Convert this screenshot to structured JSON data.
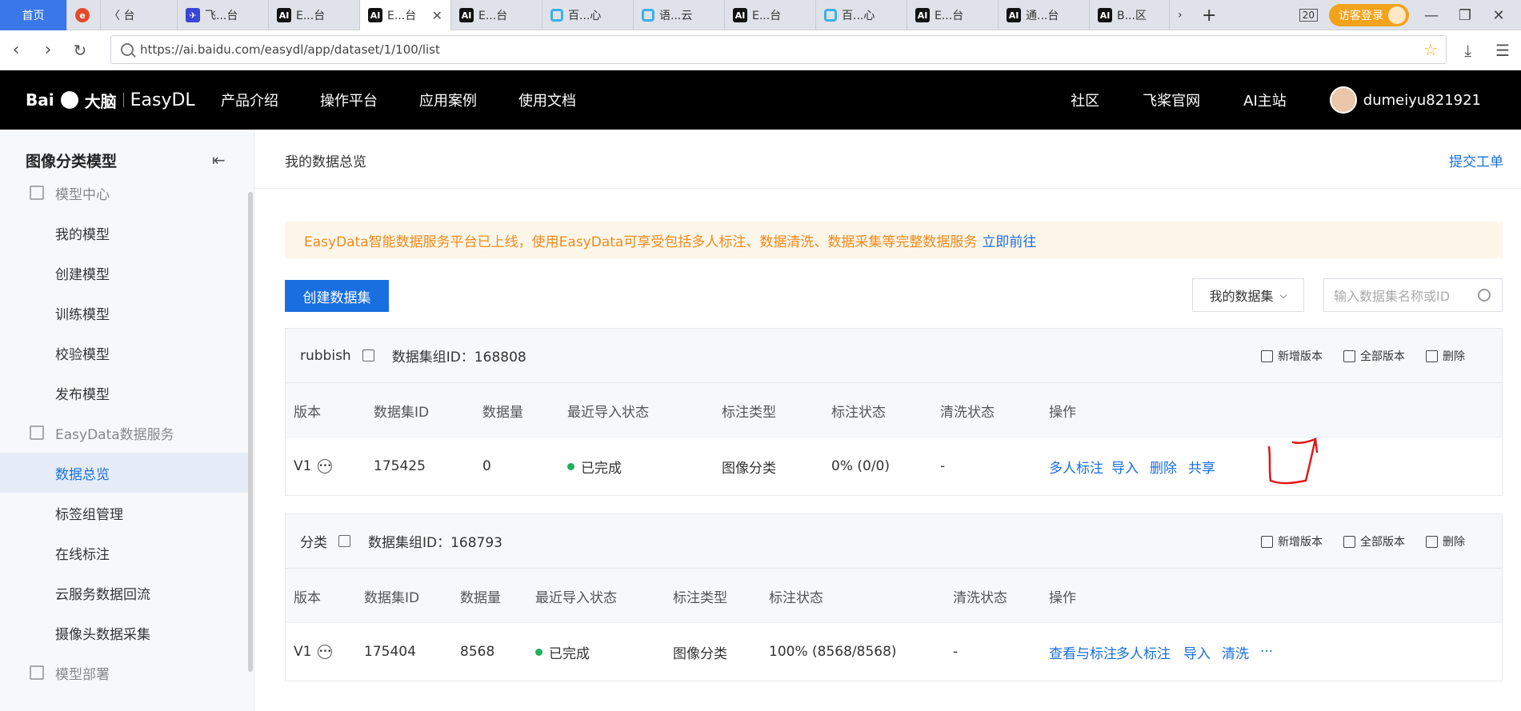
{
  "browser": {
    "home_tab": "首页",
    "tabs": [
      {
        "icon": "red",
        "label": ""
      },
      {
        "icon": "none",
        "label": "〈 台"
      },
      {
        "icon": "blue",
        "label": "飞...台"
      },
      {
        "icon": "ai",
        "label": "E...台"
      },
      {
        "icon": "ai",
        "label": "E...台",
        "active": true
      },
      {
        "icon": "ai",
        "label": "E...台"
      },
      {
        "icon": "hex",
        "label": "百...心"
      },
      {
        "icon": "hex",
        "label": "语...云"
      },
      {
        "icon": "ai",
        "label": "E...台"
      },
      {
        "icon": "hex",
        "label": "百...心"
      },
      {
        "icon": "ai",
        "label": "E...台"
      },
      {
        "icon": "ai",
        "label": "通...台"
      },
      {
        "icon": "ai",
        "label": "B...区"
      }
    ],
    "tab_count": "20",
    "visitor_login": "访客登录",
    "url": "https://ai.baidu.com/easydl/app/dataset/1/100/list"
  },
  "header": {
    "logo_text": "Bai",
    "logo_cn": "大脑",
    "product": "EasyDL",
    "nav": [
      "产品介绍",
      "操作平台",
      "应用案例",
      "使用文档"
    ],
    "right_links": [
      "社区",
      "飞桨官网",
      "AI主站"
    ],
    "username": "dumeiyu821921"
  },
  "sidebar": {
    "title": "图像分类模型",
    "items": [
      {
        "label": "模型中心",
        "group": true
      },
      {
        "label": "我的模型"
      },
      {
        "label": "创建模型"
      },
      {
        "label": "训练模型"
      },
      {
        "label": "校验模型"
      },
      {
        "label": "发布模型"
      },
      {
        "label": "EasyData数据服务",
        "group": true
      },
      {
        "label": "数据总览",
        "active": true
      },
      {
        "label": "标签组管理"
      },
      {
        "label": "在线标注"
      },
      {
        "label": "云服务数据回流"
      },
      {
        "label": "摄像头数据采集"
      },
      {
        "label": "模型部署",
        "group": true
      }
    ]
  },
  "main": {
    "page_title": "我的数据总览",
    "submit_ticket": "提交工单",
    "notice_text": "EasyData智能数据服务平台已上线，使用EasyData可享受包括多人标注、数据清洗、数据采集等完整数据服务",
    "notice_link": "立即前往",
    "create_button": "创建数据集",
    "filter_label": "我的数据集",
    "search_placeholder": "输入数据集名称或ID",
    "card_actions": [
      "新增版本",
      "全部版本",
      "删除"
    ],
    "datasets": [
      {
        "name": "rubbish",
        "group_id_label": "数据集组ID：168808",
        "headers": [
          "版本",
          "数据集ID",
          "数据量",
          "最近导入状态",
          "标注类型",
          "标注状态",
          "清洗状态",
          "操作"
        ],
        "row": {
          "version": "V1",
          "id": "175425",
          "count": "0",
          "import_status": "已完成",
          "label_type": "图像分类",
          "label_status": "0% (0/0)",
          "clean_status": "-",
          "ops": [
            "多人标注",
            "导入",
            "删除",
            "共享"
          ]
        }
      },
      {
        "name": "分类",
        "group_id_label": "数据集组ID：168793",
        "headers": [
          "版本",
          "数据集ID",
          "数据量",
          "最近导入状态",
          "标注类型",
          "标注状态",
          "清洗状态",
          "操作"
        ],
        "row": {
          "version": "V1",
          "id": "175404",
          "count": "8568",
          "import_status": "已完成",
          "label_type": "图像分类",
          "label_status": "100% (8568/8568)",
          "clean_status": "-",
          "ops": [
            "查看与标注",
            "多人标注",
            "导入",
            "清洗",
            "···"
          ]
        }
      }
    ]
  }
}
